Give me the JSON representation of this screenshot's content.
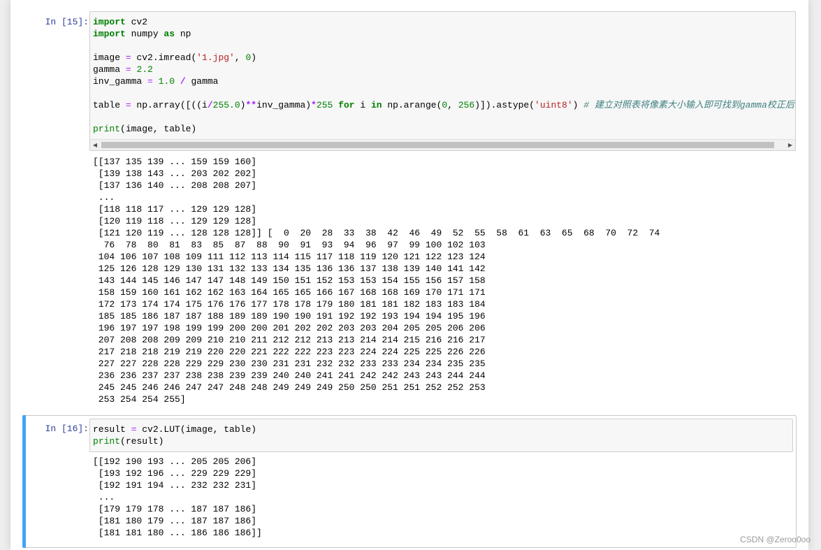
{
  "cells": [
    {
      "prompt": "In  [15]:",
      "code": [
        {
          "segments": [
            {
              "t": "import",
              "c": "kw"
            },
            {
              "t": " cv2",
              "c": ""
            }
          ]
        },
        {
          "segments": [
            {
              "t": "import",
              "c": "kw"
            },
            {
              "t": " numpy ",
              "c": ""
            },
            {
              "t": "as",
              "c": "kw"
            },
            {
              "t": " np",
              "c": ""
            }
          ]
        },
        {
          "segments": []
        },
        {
          "segments": [
            {
              "t": "image ",
              "c": ""
            },
            {
              "t": "=",
              "c": "eq"
            },
            {
              "t": " cv2.imread(",
              "c": ""
            },
            {
              "t": "'1.jpg'",
              "c": "str"
            },
            {
              "t": ", ",
              "c": ""
            },
            {
              "t": "0",
              "c": "num"
            },
            {
              "t": ")",
              "c": ""
            }
          ]
        },
        {
          "segments": [
            {
              "t": "gamma ",
              "c": ""
            },
            {
              "t": "=",
              "c": "eq"
            },
            {
              "t": " ",
              "c": ""
            },
            {
              "t": "2.2",
              "c": "num"
            }
          ]
        },
        {
          "segments": [
            {
              "t": "inv_gamma ",
              "c": ""
            },
            {
              "t": "=",
              "c": "eq"
            },
            {
              "t": " ",
              "c": ""
            },
            {
              "t": "1.0",
              "c": "num"
            },
            {
              "t": " ",
              "c": ""
            },
            {
              "t": "/",
              "c": "op"
            },
            {
              "t": " gamma",
              "c": ""
            }
          ]
        },
        {
          "segments": []
        },
        {
          "segments": [
            {
              "t": "table ",
              "c": ""
            },
            {
              "t": "=",
              "c": "eq"
            },
            {
              "t": " np.array([((i",
              "c": ""
            },
            {
              "t": "/",
              "c": "op"
            },
            {
              "t": "255.0",
              "c": "num"
            },
            {
              "t": ")",
              "c": ""
            },
            {
              "t": "**",
              "c": "op"
            },
            {
              "t": "inv_gamma)",
              "c": ""
            },
            {
              "t": "*",
              "c": "op"
            },
            {
              "t": "255",
              "c": "num"
            },
            {
              "t": " ",
              "c": ""
            },
            {
              "t": "for",
              "c": "kw"
            },
            {
              "t": " i ",
              "c": ""
            },
            {
              "t": "in",
              "c": "kw"
            },
            {
              "t": " np.arange(",
              "c": ""
            },
            {
              "t": "0",
              "c": "num"
            },
            {
              "t": ", ",
              "c": ""
            },
            {
              "t": "256",
              "c": "num"
            },
            {
              "t": ")]).astype(",
              "c": ""
            },
            {
              "t": "'uint8'",
              "c": "str"
            },
            {
              "t": ") ",
              "c": ""
            },
            {
              "t": "# 建立对照表将像素大小输入即可找到gamma校正后的像素值",
              "c": "cm"
            }
          ]
        },
        {
          "segments": []
        },
        {
          "segments": [
            {
              "t": "print",
              "c": "bi"
            },
            {
              "t": "(image, table)",
              "c": ""
            }
          ]
        }
      ],
      "output": [
        "[[137 135 139 ... 159 159 160]",
        " [139 138 143 ... 203 202 202]",
        " [137 136 140 ... 208 208 207]",
        " ...",
        " [118 118 117 ... 129 129 128]",
        " [120 119 118 ... 129 129 128]",
        " [121 120 119 ... 128 128 128]] [  0  20  28  33  38  42  46  49  52  55  58  61  63  65  68  70  72  74",
        "  76  78  80  81  83  85  87  88  90  91  93  94  96  97  99 100 102 103",
        " 104 106 107 108 109 111 112 113 114 115 117 118 119 120 121 122 123 124",
        " 125 126 128 129 130 131 132 133 134 135 136 136 137 138 139 140 141 142",
        " 143 144 145 146 147 147 148 149 150 151 152 153 153 154 155 156 157 158",
        " 158 159 160 161 162 162 163 164 165 165 166 167 168 168 169 170 171 171",
        " 172 173 174 174 175 176 176 177 178 178 179 180 181 181 182 183 183 184",
        " 185 185 186 187 187 188 189 189 190 190 191 192 192 193 194 194 195 196",
        " 196 197 197 198 199 199 200 200 201 202 202 203 203 204 205 205 206 206",
        " 207 208 208 209 209 210 210 211 212 212 213 213 214 214 215 216 216 217",
        " 217 218 218 219 219 220 220 221 222 222 223 223 224 224 225 225 226 226",
        " 227 227 228 228 229 229 230 230 231 231 232 232 233 233 234 234 235 235",
        " 236 236 237 237 238 238 239 239 240 240 241 241 242 242 243 243 244 244",
        " 245 245 246 246 247 247 248 248 249 249 249 250 250 251 251 252 252 253",
        " 253 254 254 255]"
      ]
    },
    {
      "prompt": "In  [16]:",
      "code": [
        {
          "segments": [
            {
              "t": "result ",
              "c": ""
            },
            {
              "t": "=",
              "c": "eq"
            },
            {
              "t": " cv2.LUT(image, table)",
              "c": ""
            }
          ]
        },
        {
          "segments": [
            {
              "t": "print",
              "c": "bi"
            },
            {
              "t": "(result)",
              "c": ""
            }
          ]
        }
      ],
      "output": [
        "[[192 190 193 ... 205 205 206]",
        " [193 192 196 ... 229 229 229]",
        " [192 191 194 ... 232 232 231]",
        " ...",
        " [179 179 178 ... 187 187 186]",
        " [181 180 179 ... 187 187 186]",
        " [181 181 180 ... 186 186 186]]"
      ]
    }
  ],
  "watermark": "CSDN @Zeroo0oo",
  "colors": {
    "prompt": "#303f9f",
    "selected_bar": "#42a5f5",
    "keyword": "#008000",
    "string": "#ba2121",
    "comment": "#408080"
  }
}
